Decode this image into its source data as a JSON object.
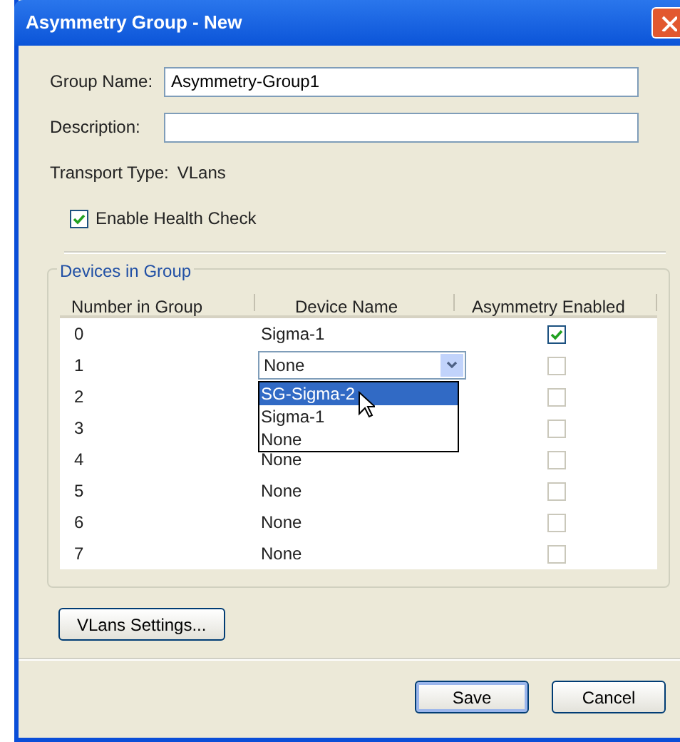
{
  "window": {
    "title": "Asymmetry Group - New"
  },
  "fields": [
    {
      "label": "Group Name:",
      "value": "Asymmetry-Group1"
    },
    {
      "label": "Description:"
    }
  ],
  "transport": {
    "label": "Transport Type:",
    "value": "VLans"
  },
  "health_check": {
    "label": "Enable Health Check",
    "checked": true
  },
  "devices": {
    "title": "Devices in Group",
    "columns": [
      "Number in Group",
      "Device Name",
      "Asymmetry Enabled"
    ],
    "rows": [
      {
        "number": "0",
        "device": "Sigma-1",
        "kind": "text",
        "checked": true,
        "disabled": false
      },
      {
        "number": "1",
        "device": "None",
        "kind": "combo",
        "checked": false,
        "disabled": true
      },
      {
        "number": "2",
        "kind": "hidden",
        "checked": false,
        "disabled": true
      },
      {
        "number": "3",
        "kind": "hidden",
        "checked": false,
        "disabled": true
      },
      {
        "number": "4",
        "device": "None",
        "kind": "text",
        "checked": false,
        "disabled": true
      },
      {
        "number": "5",
        "device": "None",
        "kind": "text",
        "checked": false,
        "disabled": true
      },
      {
        "number": "6",
        "device": "None",
        "kind": "text",
        "checked": false,
        "disabled": true
      },
      {
        "number": "7",
        "device": "None",
        "kind": "text",
        "checked": false,
        "disabled": true
      }
    ],
    "dropdown_options": [
      {
        "label": "SG-Sigma-2",
        "selected": true
      },
      {
        "label": "Sigma-1",
        "selected": false
      },
      {
        "label": "None",
        "selected": false
      }
    ]
  },
  "buttons": [
    {
      "label": "VLans Settings...",
      "kind": "settings"
    },
    {
      "label": "Save",
      "kind": "default"
    },
    {
      "label": "Cancel",
      "kind": "normal"
    }
  ]
}
